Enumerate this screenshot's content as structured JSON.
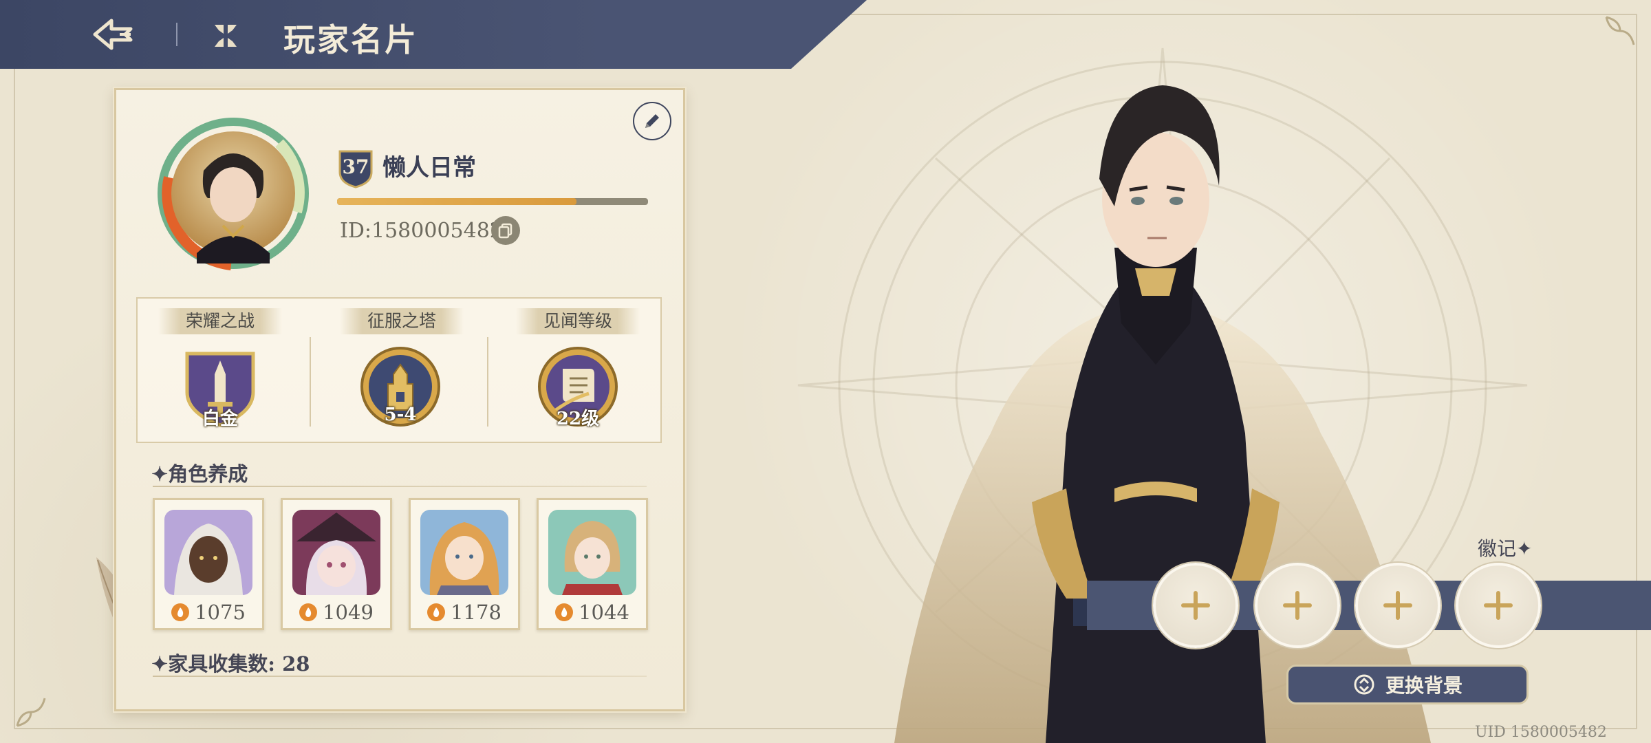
{
  "header": {
    "title": "玩家名片"
  },
  "player": {
    "level": "37",
    "name": "懒人日常",
    "id_text": "ID:1580005482",
    "xp_progress": 0.77
  },
  "stats": [
    {
      "label": "荣耀之战",
      "value": "白金",
      "icon": "sword-shield-icon"
    },
    {
      "label": "征服之塔",
      "value": "5-4",
      "icon": "tower-medal-icon"
    },
    {
      "label": "见闻等级",
      "value": "22级",
      "icon": "scroll-quill-icon"
    }
  ],
  "characters_section": {
    "title": "✦角色养成"
  },
  "characters": [
    {
      "power": "1075"
    },
    {
      "power": "1049"
    },
    {
      "power": "1178"
    },
    {
      "power": "1044"
    }
  ],
  "furniture": {
    "label": "✦家具收集数: 28"
  },
  "badges": {
    "title": "徽记✦",
    "slots": 4
  },
  "actions": {
    "change_background": "更换背景"
  },
  "footer": {
    "uid": "UID 1580005482"
  },
  "colors": {
    "navy": "#3c4664",
    "gold": "#d99a3c",
    "paper": "#ebe4d1"
  }
}
